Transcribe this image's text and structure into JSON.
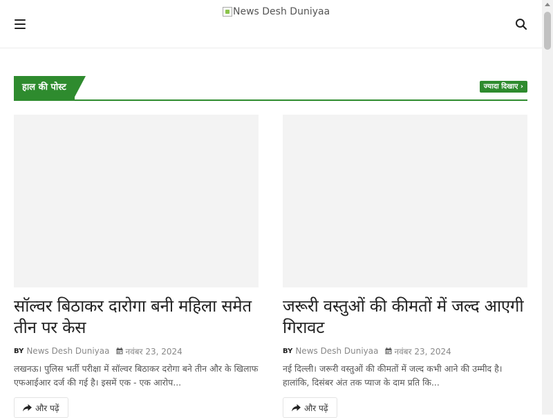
{
  "header": {
    "logo_text": "News Desh Duniyaa",
    "menu_icon": "hamburger-menu-icon",
    "search_icon": "search-icon"
  },
  "section": {
    "title": "हाल की पोस्ट",
    "view_more": "ज्यादा दिखाए ›",
    "accent_color": "#2e8b2e"
  },
  "posts": [
    {
      "title": "सॉल्वर बिठाकर दारोगा बनी महिला समेत तीन पर केस",
      "by": "BY",
      "author": "News Desh Duniyaa",
      "date": "नवंबर 23, 2024",
      "excerpt": "लखनऊ।    पुलिस भर्ती परीक्षा में सॉल्वर बिठाकर  दरोगा बने तीन और के खिलाफ एफआईआर दर्ज  की गई है।  इसमें एक - एक  आरोप...",
      "read_more": "और पढ़ें"
    },
    {
      "title": "जरूरी वस्तुओं की कीमतों में जल्द आएगी गिरावट",
      "by": "BY",
      "author": "News Desh Duniyaa",
      "date": "नवंबर 23, 2024",
      "excerpt": "नई दिल्ली।    जरूरी वस्तुओं की कीमतों में जल्द कभी आने की उम्मीद है।  हालांकि, दिसंबर अंत तक प्याज  के दाम  प्रति  कि...",
      "read_more": "और पढ़ें"
    }
  ]
}
